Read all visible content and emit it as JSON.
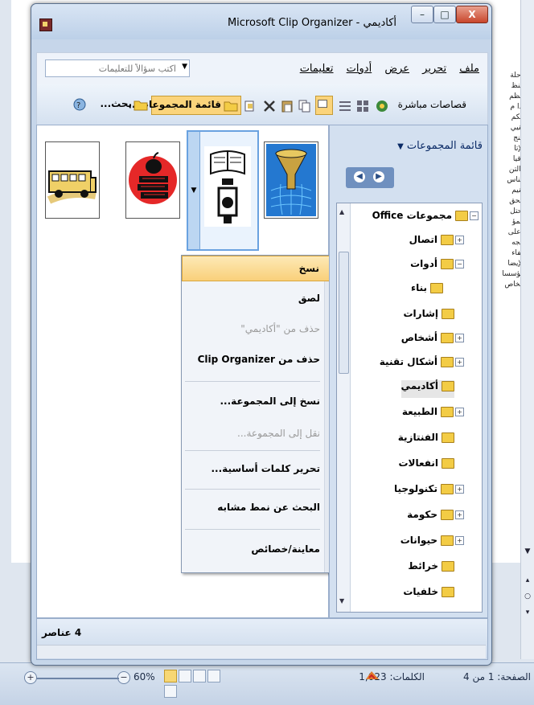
{
  "window": {
    "title": "أكاديمي - Microsoft Clip Organizer",
    "minimize": "–",
    "maximize": "□",
    "close": "X"
  },
  "menubar": {
    "items": [
      "ملف",
      "تحرير",
      "عرض",
      "أدوات",
      "تعليمات"
    ],
    "ask_placeholder": "اكتب سؤالاً للتعليمات"
  },
  "toolbar": {
    "search_label": "بحث...",
    "collection_list_label": "قائمة المجموعات...",
    "live_clips_label": "قصاصات مباشرة"
  },
  "task_pane": {
    "title": "قائمة المجموعات",
    "tree": [
      {
        "label": "مجموعات Office",
        "expand": "−"
      },
      {
        "label": "اتصال",
        "expand": "+"
      },
      {
        "label": "أدوات",
        "expand": "−"
      },
      {
        "label": "بناء",
        "expand": ""
      },
      {
        "label": "إشارات",
        "expand": ""
      },
      {
        "label": "أشخاص",
        "expand": "+"
      },
      {
        "label": "أشكال تقنية",
        "expand": "+"
      },
      {
        "label": "أكاديمي",
        "expand": ""
      },
      {
        "label": "الطبيعة",
        "expand": "+"
      },
      {
        "label": "الفنتازية",
        "expand": ""
      },
      {
        "label": "انفعالات",
        "expand": ""
      },
      {
        "label": "تكنولوجيا",
        "expand": "+"
      },
      {
        "label": "حكومة",
        "expand": "+"
      },
      {
        "label": "حيوانات",
        "expand": "+"
      },
      {
        "label": "خرائط",
        "expand": ""
      },
      {
        "label": "خلفيات",
        "expand": ""
      }
    ]
  },
  "context_menu": {
    "items": [
      {
        "label": "نسخ",
        "icon": "copy-icon",
        "disabled": false
      },
      {
        "label": "لصق",
        "icon": "paste-icon",
        "disabled": false
      },
      {
        "label": "حذف من \"أكاديمي\"",
        "icon": "",
        "disabled": true
      },
      {
        "label": "حذف من Clip Organizer",
        "icon": "delete-icon",
        "disabled": false
      },
      {
        "label": "نسخ إلى المجموعة...",
        "icon": "copy-to-collection-icon",
        "disabled": false
      },
      {
        "label": "نقل إلى المجموعة...",
        "icon": "move-to-collection-icon",
        "disabled": true
      },
      {
        "label": "تحرير كلمات أساسية...",
        "icon": "",
        "disabled": false
      },
      {
        "label": "البحث عن نمط مشابه",
        "icon": "",
        "disabled": false
      },
      {
        "label": "معاينة/خصائص",
        "icon": "",
        "disabled": false
      }
    ]
  },
  "status": {
    "count": "4 عناصر"
  },
  "word_status": {
    "page": "الصفحة: 1 من 4",
    "words": "الكلمات: 1,023",
    "zoom": "60%"
  },
  "background_text": [
    "رحلة",
    "النظ",
    "لنظم",
    "",
    "إذا م",
    "الكم",
    "تقيي",
    "",
    "النج",
    "الإتا",
    "وقيا",
    "والتن",
    "يتناس",
    "تقيم",
    "لتحق",
    "",
    "يحتل",
    "المؤ",
    "",
    "وعلى",
    "الجه",
    "كفاء",
    "الإيضا",
    "مؤسسا",
    "الخاص"
  ],
  "colors": {
    "accent": "#fbd47b",
    "window": "#c6d6ea"
  }
}
